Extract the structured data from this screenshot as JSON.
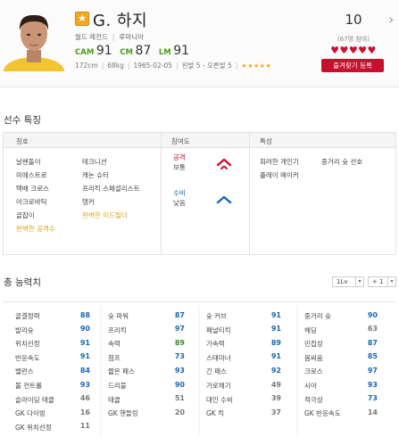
{
  "player": {
    "name": "G. 하지",
    "season_label": "월드 레전드",
    "nation": "루마니아",
    "positions": [
      {
        "label": "CAM",
        "value": "91"
      },
      {
        "label": "CM",
        "value": "87"
      },
      {
        "label": "LM",
        "value": "91"
      }
    ],
    "height": "172cm",
    "weight": "68kg",
    "birth": "1965-02-05",
    "foot": "왼발 5 - 오른발 5",
    "skill_stars": "★★★★★"
  },
  "rating": {
    "score": "10",
    "votes": "(67명 참여)",
    "hearts": "♥♥♥♥♥",
    "favorite_button": "즐겨찾기 등록"
  },
  "traits": {
    "section_title": "선수 특징",
    "col_titles": [
      "칭호",
      "참여도",
      "특성"
    ],
    "titles_col1": [
      {
        "text": "날쌘돌이",
        "gold": false
      },
      {
        "text": "미에스트로",
        "gold": false
      },
      {
        "text": "택배 크로스",
        "gold": false
      },
      {
        "text": "아크로바틱",
        "gold": false
      },
      {
        "text": "골잡이",
        "gold": false
      },
      {
        "text": "완벽한 공격수",
        "gold": true
      }
    ],
    "titles_col2": [
      {
        "text": "테크니션",
        "gold": false
      },
      {
        "text": "캐논 슈터",
        "gold": false
      },
      {
        "text": "프리킥 스페셜리스트",
        "gold": false
      },
      {
        "text": "탱커",
        "gold": false
      },
      {
        "text": "완벽한 미드필더",
        "gold": true
      }
    ],
    "participation": {
      "attack_label": "공격",
      "attack_value": "보통",
      "attack_color": "#c8102e",
      "defense_label": "수비",
      "defense_value": "낮음",
      "defense_color": "#1a66b4"
    },
    "specialties": [
      "화려한 개인기",
      "중거리 슛 선호",
      "플레이 메이커"
    ]
  },
  "abilities": {
    "section_title": "총 능력치",
    "level_select": "1Lv",
    "plus_select": "+ 1",
    "colors": {
      "blue": "#1a66b4",
      "green": "#3c8a2e",
      "gray": "#777777"
    },
    "rows": [
      [
        {
          "name": "골결정력",
          "value": 88,
          "tone": "blue"
        },
        {
          "name": "슛 파워",
          "value": 87,
          "tone": "blue"
        },
        {
          "name": "슛 커브",
          "value": 91,
          "tone": "blue"
        },
        {
          "name": "중거리 슛",
          "value": 90,
          "tone": "blue"
        }
      ],
      [
        {
          "name": "발리슛",
          "value": 90,
          "tone": "blue"
        },
        {
          "name": "프리킥",
          "value": 97,
          "tone": "blue"
        },
        {
          "name": "페널티킥",
          "value": 91,
          "tone": "blue"
        },
        {
          "name": "헤딩",
          "value": 63,
          "tone": "gray"
        }
      ],
      [
        {
          "name": "위치선정",
          "value": 91,
          "tone": "blue"
        },
        {
          "name": "속력",
          "value": 89,
          "tone": "green"
        },
        {
          "name": "가속력",
          "value": 89,
          "tone": "blue"
        },
        {
          "name": "민첩성",
          "value": 87,
          "tone": "blue"
        }
      ],
      [
        {
          "name": "반응속도",
          "value": 91,
          "tone": "blue"
        },
        {
          "name": "점프",
          "value": 73,
          "tone": "blue"
        },
        {
          "name": "스태미너",
          "value": 91,
          "tone": "blue"
        },
        {
          "name": "몸싸움",
          "value": 85,
          "tone": "blue"
        }
      ],
      [
        {
          "name": "밸런스",
          "value": 84,
          "tone": "blue"
        },
        {
          "name": "짧은 패스",
          "value": 93,
          "tone": "blue"
        },
        {
          "name": "긴 패스",
          "value": 92,
          "tone": "blue"
        },
        {
          "name": "크로스",
          "value": 97,
          "tone": "blue"
        }
      ],
      [
        {
          "name": "볼 컨트롤",
          "value": 93,
          "tone": "blue"
        },
        {
          "name": "드리블",
          "value": 90,
          "tone": "blue"
        },
        {
          "name": "가로채기",
          "value": 49,
          "tone": "gray"
        },
        {
          "name": "시야",
          "value": 93,
          "tone": "blue"
        }
      ],
      [
        {
          "name": "슬라이딩 태클",
          "value": 46,
          "tone": "gray"
        },
        {
          "name": "태클",
          "value": 51,
          "tone": "gray"
        },
        {
          "name": "대인 수비",
          "value": 39,
          "tone": "gray"
        },
        {
          "name": "적극성",
          "value": 73,
          "tone": "blue"
        }
      ],
      [
        {
          "name": "GK 다이빙",
          "value": 16,
          "tone": "gray"
        },
        {
          "name": "GK 핸들링",
          "value": 20,
          "tone": "gray"
        },
        {
          "name": "GK 킥",
          "value": 37,
          "tone": "gray"
        },
        {
          "name": "GK 반응속도",
          "value": 14,
          "tone": "gray"
        }
      ],
      [
        {
          "name": "GK 위치선정",
          "value": 11,
          "tone": "gray"
        }
      ]
    ]
  }
}
